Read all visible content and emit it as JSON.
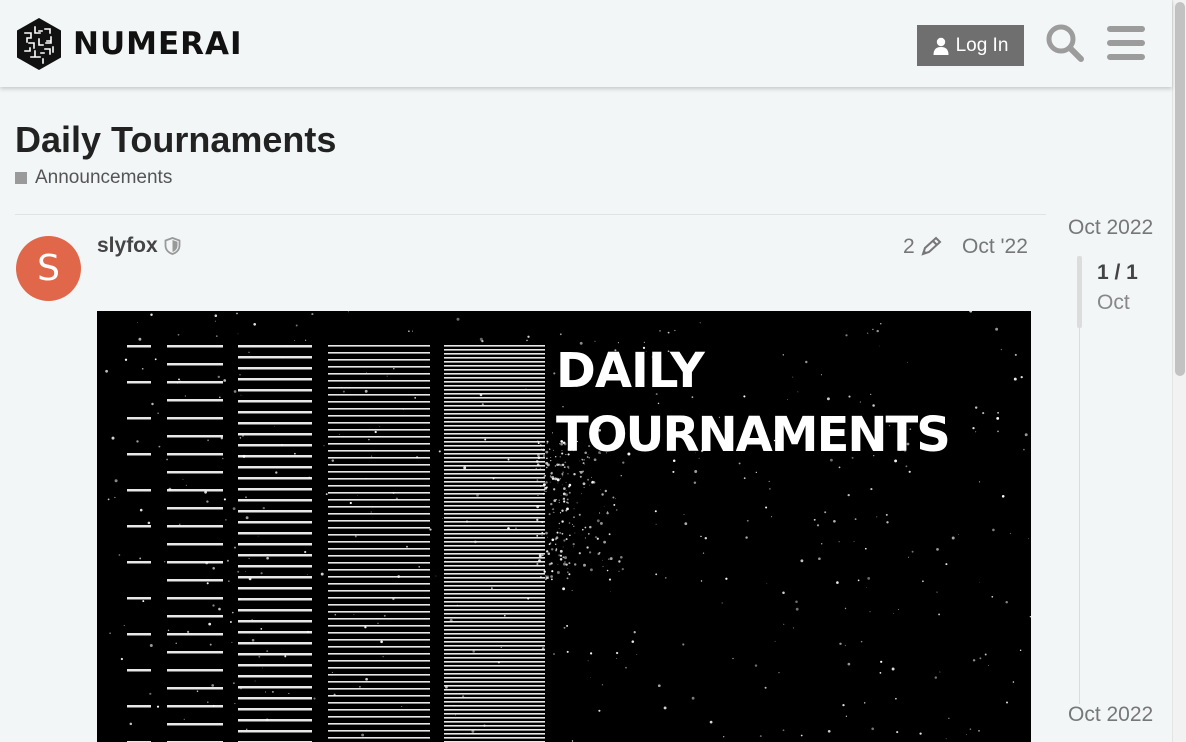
{
  "header": {
    "logo_text": "NUMERAI",
    "login_label": "Log In",
    "search_icon": "search-icon",
    "menu_icon": "hamburger-menu-icon"
  },
  "topic": {
    "title": "Daily Tournaments",
    "category": "Announcements",
    "category_color": "#9a9a9a"
  },
  "post": {
    "author": "slyfox",
    "author_initial": "S",
    "avatar_color": "#e1674a",
    "edit_count": "2",
    "date": "Oct '22",
    "image": {
      "line1": "DAILY",
      "line2": "TOURNAMENTS"
    }
  },
  "timeline": {
    "top_date": "Oct 2022",
    "position": "1 / 1",
    "sub": "Oct",
    "bottom_date": "Oct 2022"
  },
  "colors": {
    "background": "#f2f6f7",
    "button": "#6f6f6f"
  }
}
